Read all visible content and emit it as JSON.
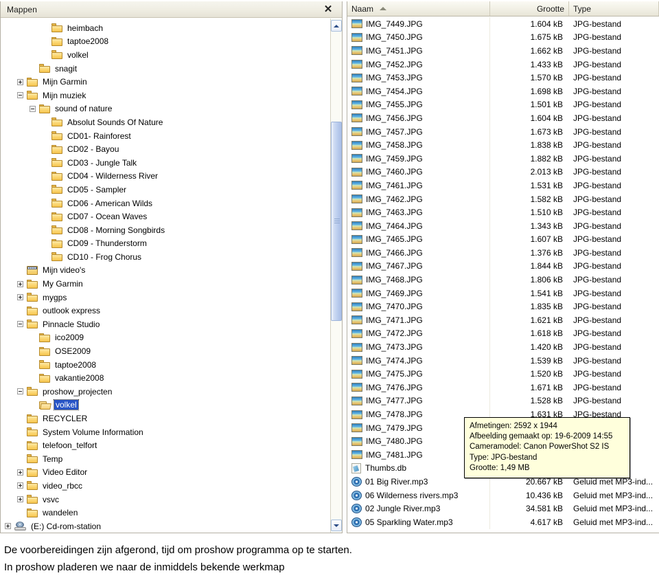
{
  "folders_panel": {
    "title": "Mappen",
    "close_icon": "✕",
    "tree": [
      {
        "label": "heimbach",
        "indent": 4,
        "toggle": "none",
        "icon": "folder-icon"
      },
      {
        "label": "taptoe2008",
        "indent": 4,
        "toggle": "none",
        "icon": "folder-icon"
      },
      {
        "label": "volkel",
        "indent": 4,
        "toggle": "none",
        "icon": "folder-icon"
      },
      {
        "label": "snagit",
        "indent": 3,
        "toggle": "none",
        "icon": "folder-icon"
      },
      {
        "label": "Mijn Garmin",
        "indent": 2,
        "toggle": "plus",
        "icon": "folder-icon"
      },
      {
        "label": "Mijn muziek",
        "indent": 2,
        "toggle": "minus",
        "icon": "folder-icon"
      },
      {
        "label": "sound of nature",
        "indent": 3,
        "toggle": "minus",
        "icon": "folder-icon"
      },
      {
        "label": "Absolut Sounds Of Nature",
        "indent": 4,
        "toggle": "none",
        "icon": "folder-icon"
      },
      {
        "label": "CD01- Rainforest",
        "indent": 4,
        "toggle": "none",
        "icon": "folder-icon"
      },
      {
        "label": "CD02 - Bayou",
        "indent": 4,
        "toggle": "none",
        "icon": "folder-icon"
      },
      {
        "label": "CD03 - Jungle Talk",
        "indent": 4,
        "toggle": "none",
        "icon": "folder-icon"
      },
      {
        "label": "CD04 - Wilderness River",
        "indent": 4,
        "toggle": "none",
        "icon": "folder-icon"
      },
      {
        "label": "CD05 - Sampler",
        "indent": 4,
        "toggle": "none",
        "icon": "folder-icon"
      },
      {
        "label": "CD06 - American Wilds",
        "indent": 4,
        "toggle": "none",
        "icon": "folder-icon"
      },
      {
        "label": "CD07 - Ocean Waves",
        "indent": 4,
        "toggle": "none",
        "icon": "folder-icon"
      },
      {
        "label": "CD08 - Morning Songbirds",
        "indent": 4,
        "toggle": "none",
        "icon": "folder-icon"
      },
      {
        "label": "CD09 - Thunderstorm",
        "indent": 4,
        "toggle": "none",
        "icon": "folder-icon"
      },
      {
        "label": "CD10 - Frog Chorus",
        "indent": 4,
        "toggle": "none",
        "icon": "folder-icon"
      },
      {
        "label": "Mijn video's",
        "indent": 2,
        "toggle": "none",
        "icon": "video-folder-icon"
      },
      {
        "label": "My Garmin",
        "indent": 2,
        "toggle": "plus",
        "icon": "folder-icon"
      },
      {
        "label": "mygps",
        "indent": 2,
        "toggle": "plus",
        "icon": "folder-icon"
      },
      {
        "label": "outlook express",
        "indent": 2,
        "toggle": "none",
        "icon": "folder-icon"
      },
      {
        "label": "Pinnacle Studio",
        "indent": 2,
        "toggle": "minus",
        "icon": "folder-icon"
      },
      {
        "label": "ico2009",
        "indent": 3,
        "toggle": "none",
        "icon": "folder-icon"
      },
      {
        "label": "OSE2009",
        "indent": 3,
        "toggle": "none",
        "icon": "folder-icon"
      },
      {
        "label": "taptoe2008",
        "indent": 3,
        "toggle": "none",
        "icon": "folder-icon"
      },
      {
        "label": "vakantie2008",
        "indent": 3,
        "toggle": "none",
        "icon": "folder-icon"
      },
      {
        "label": "proshow_projecten",
        "indent": 2,
        "toggle": "minus",
        "icon": "folder-icon"
      },
      {
        "label": "volkel",
        "indent": 3,
        "toggle": "none",
        "icon": "folder-open-icon",
        "selected": true
      },
      {
        "label": "RECYCLER",
        "indent": 2,
        "toggle": "none",
        "icon": "folder-icon"
      },
      {
        "label": "System Volume Information",
        "indent": 2,
        "toggle": "none",
        "icon": "folder-icon"
      },
      {
        "label": "telefoon_telfort",
        "indent": 2,
        "toggle": "none",
        "icon": "folder-icon"
      },
      {
        "label": "Temp",
        "indent": 2,
        "toggle": "none",
        "icon": "folder-icon"
      },
      {
        "label": "Video Editor",
        "indent": 2,
        "toggle": "plus",
        "icon": "folder-icon"
      },
      {
        "label": "video_rbcc",
        "indent": 2,
        "toggle": "plus",
        "icon": "folder-icon"
      },
      {
        "label": "vsvc",
        "indent": 2,
        "toggle": "plus",
        "icon": "folder-icon"
      },
      {
        "label": "wandelen",
        "indent": 2,
        "toggle": "none",
        "icon": "folder-icon"
      },
      {
        "label": "(E:) Cd-rom-station",
        "indent": 1,
        "toggle": "plus",
        "icon": "cdrom-drive-icon"
      }
    ]
  },
  "file_list": {
    "columns": {
      "name": "Naam",
      "size": "Grootte",
      "type": "Type",
      "sort_indicator": "ascending"
    },
    "rows": [
      {
        "name": "IMG_7449.JPG",
        "size": "1.604 kB",
        "type": "JPG-bestand",
        "icon": "jpg-icon"
      },
      {
        "name": "IMG_7450.JPG",
        "size": "1.675 kB",
        "type": "JPG-bestand",
        "icon": "jpg-icon"
      },
      {
        "name": "IMG_7451.JPG",
        "size": "1.662 kB",
        "type": "JPG-bestand",
        "icon": "jpg-icon"
      },
      {
        "name": "IMG_7452.JPG",
        "size": "1.433 kB",
        "type": "JPG-bestand",
        "icon": "jpg-icon"
      },
      {
        "name": "IMG_7453.JPG",
        "size": "1.570 kB",
        "type": "JPG-bestand",
        "icon": "jpg-icon"
      },
      {
        "name": "IMG_7454.JPG",
        "size": "1.698 kB",
        "type": "JPG-bestand",
        "icon": "jpg-icon"
      },
      {
        "name": "IMG_7455.JPG",
        "size": "1.501 kB",
        "type": "JPG-bestand",
        "icon": "jpg-icon"
      },
      {
        "name": "IMG_7456.JPG",
        "size": "1.604 kB",
        "type": "JPG-bestand",
        "icon": "jpg-icon"
      },
      {
        "name": "IMG_7457.JPG",
        "size": "1.673 kB",
        "type": "JPG-bestand",
        "icon": "jpg-icon"
      },
      {
        "name": "IMG_7458.JPG",
        "size": "1.838 kB",
        "type": "JPG-bestand",
        "icon": "jpg-icon"
      },
      {
        "name": "IMG_7459.JPG",
        "size": "1.882 kB",
        "type": "JPG-bestand",
        "icon": "jpg-icon"
      },
      {
        "name": "IMG_7460.JPG",
        "size": "2.013 kB",
        "type": "JPG-bestand",
        "icon": "jpg-icon"
      },
      {
        "name": "IMG_7461.JPG",
        "size": "1.531 kB",
        "type": "JPG-bestand",
        "icon": "jpg-icon"
      },
      {
        "name": "IMG_7462.JPG",
        "size": "1.582 kB",
        "type": "JPG-bestand",
        "icon": "jpg-icon"
      },
      {
        "name": "IMG_7463.JPG",
        "size": "1.510 kB",
        "type": "JPG-bestand",
        "icon": "jpg-icon"
      },
      {
        "name": "IMG_7464.JPG",
        "size": "1.343 kB",
        "type": "JPG-bestand",
        "icon": "jpg-icon"
      },
      {
        "name": "IMG_7465.JPG",
        "size": "1.607 kB",
        "type": "JPG-bestand",
        "icon": "jpg-icon"
      },
      {
        "name": "IMG_7466.JPG",
        "size": "1.376 kB",
        "type": "JPG-bestand",
        "icon": "jpg-icon"
      },
      {
        "name": "IMG_7467.JPG",
        "size": "1.844 kB",
        "type": "JPG-bestand",
        "icon": "jpg-icon"
      },
      {
        "name": "IMG_7468.JPG",
        "size": "1.806 kB",
        "type": "JPG-bestand",
        "icon": "jpg-icon"
      },
      {
        "name": "IMG_7469.JPG",
        "size": "1.541 kB",
        "type": "JPG-bestand",
        "icon": "jpg-icon"
      },
      {
        "name": "IMG_7470.JPG",
        "size": "1.835 kB",
        "type": "JPG-bestand",
        "icon": "jpg-icon"
      },
      {
        "name": "IMG_7471.JPG",
        "size": "1.621 kB",
        "type": "JPG-bestand",
        "icon": "jpg-icon"
      },
      {
        "name": "IMG_7472.JPG",
        "size": "1.618 kB",
        "type": "JPG-bestand",
        "icon": "jpg-icon"
      },
      {
        "name": "IMG_7473.JPG",
        "size": "1.420 kB",
        "type": "JPG-bestand",
        "icon": "jpg-icon"
      },
      {
        "name": "IMG_7474.JPG",
        "size": "1.539 kB",
        "type": "JPG-bestand",
        "icon": "jpg-icon"
      },
      {
        "name": "IMG_7475.JPG",
        "size": "1.520 kB",
        "type": "JPG-bestand",
        "icon": "jpg-icon"
      },
      {
        "name": "IMG_7476.JPG",
        "size": "1.671 kB",
        "type": "JPG-bestand",
        "icon": "jpg-icon"
      },
      {
        "name": "IMG_7477.JPG",
        "size": "1.528 kB",
        "type": "JPG-bestand",
        "icon": "jpg-icon"
      },
      {
        "name": "IMG_7478.JPG",
        "size": "1.631 kB",
        "type": "JPG-bestand",
        "icon": "jpg-icon"
      },
      {
        "name": "IMG_7479.JPG",
        "size": "",
        "type": "",
        "icon": "jpg-icon"
      },
      {
        "name": "IMG_7480.JPG",
        "size": "",
        "type": "",
        "icon": "jpg-icon"
      },
      {
        "name": "IMG_7481.JPG",
        "size": "",
        "type": "",
        "icon": "jpg-icon"
      },
      {
        "name": "Thumbs.db",
        "size": "",
        "type": "",
        "icon": "thumbsdb-icon"
      },
      {
        "name": "01 Big River.mp3",
        "size": "20.667 kB",
        "type": "Geluid met MP3-ind...",
        "icon": "mp3-icon"
      },
      {
        "name": "06 Wilderness rivers.mp3",
        "size": "10.436 kB",
        "type": "Geluid met MP3-ind...",
        "icon": "mp3-icon"
      },
      {
        "name": "02 Jungle River.mp3",
        "size": "34.581 kB",
        "type": "Geluid met MP3-ind...",
        "icon": "mp3-icon"
      },
      {
        "name": "05 Sparkling Water.mp3",
        "size": "4.617 kB",
        "type": "Geluid met MP3-ind...",
        "icon": "mp3-icon"
      }
    ]
  },
  "tooltip": {
    "lines": [
      "Afmetingen: 2592 x 1944",
      "Afbeelding gemaakt op: 19-6-2009 14:55",
      "Cameramodel: Canon PowerShot S2 IS",
      "Type: JPG-bestand",
      "Grootte: 1,49 MB"
    ]
  },
  "caption": {
    "line1": "De voorbereidingen zijn afgerond, tijd om proshow programma op te starten.",
    "line2": "In proshow pladeren we naar de inmiddels bekende werkmap"
  },
  "colors": {
    "selection_blue": "#2754c6",
    "tooltip_bg": "#ffffdc",
    "header_bg": "#f2f0e6"
  }
}
